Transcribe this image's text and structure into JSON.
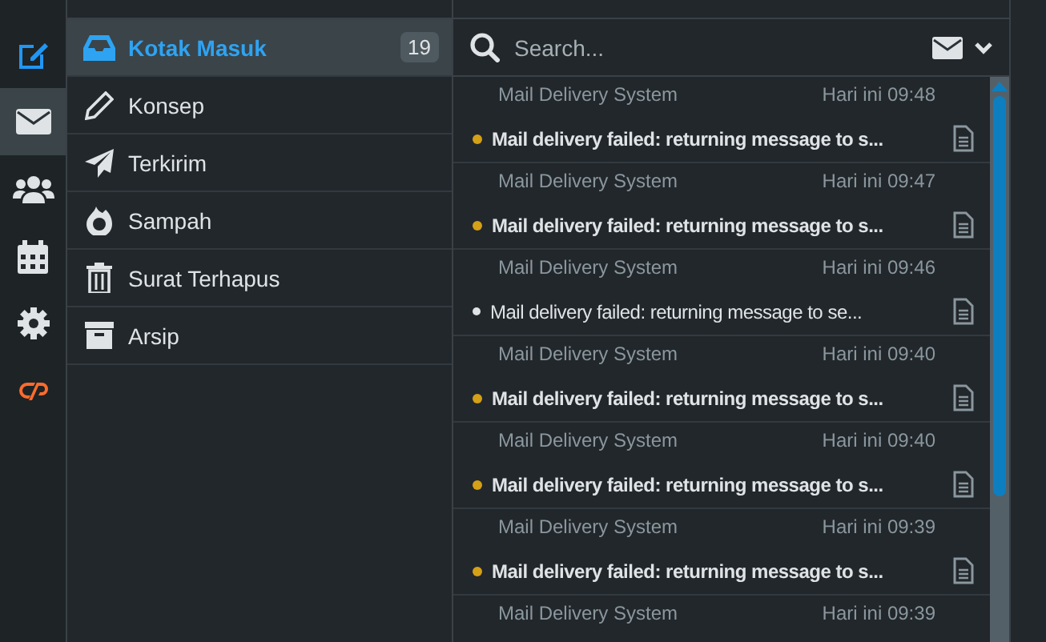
{
  "nav": [
    {
      "kind": "compose",
      "selected": false
    },
    {
      "kind": "mail",
      "selected": true
    },
    {
      "kind": "contacts",
      "selected": false
    },
    {
      "kind": "calendar",
      "selected": false
    },
    {
      "kind": "settings",
      "selected": false
    },
    {
      "kind": "cpanel",
      "selected": false
    }
  ],
  "folders": [
    {
      "kind": "inbox",
      "label": "Kotak Masuk",
      "count": "19",
      "selected": true
    },
    {
      "kind": "drafts",
      "label": "Konsep",
      "selected": false
    },
    {
      "kind": "sent",
      "label": "Terkirim",
      "selected": false
    },
    {
      "kind": "junk",
      "label": "Sampah",
      "selected": false
    },
    {
      "kind": "trash",
      "label": "Surat Terhapus",
      "selected": false
    },
    {
      "kind": "archive",
      "label": "Arsip",
      "selected": false
    }
  ],
  "search": {
    "placeholder": "Search..."
  },
  "messages": [
    {
      "sender": "Mail Delivery System",
      "time": "Hari ini 09:48",
      "subject": "Mail delivery failed: returning message to s...",
      "unread": true
    },
    {
      "sender": "Mail Delivery System",
      "time": "Hari ini 09:47",
      "subject": "Mail delivery failed: returning message to s...",
      "unread": true
    },
    {
      "sender": "Mail Delivery System",
      "time": "Hari ini 09:46",
      "subject": "Mail delivery failed: returning message to se...",
      "unread": false
    },
    {
      "sender": "Mail Delivery System",
      "time": "Hari ini 09:40",
      "subject": "Mail delivery failed: returning message to s...",
      "unread": true
    },
    {
      "sender": "Mail Delivery System",
      "time": "Hari ini 09:40",
      "subject": "Mail delivery failed: returning message to s...",
      "unread": true
    },
    {
      "sender": "Mail Delivery System",
      "time": "Hari ini 09:39",
      "subject": "Mail delivery failed: returning message to s...",
      "unread": true
    },
    {
      "sender": "Mail Delivery System",
      "time": "Hari ini 09:39"
    }
  ]
}
